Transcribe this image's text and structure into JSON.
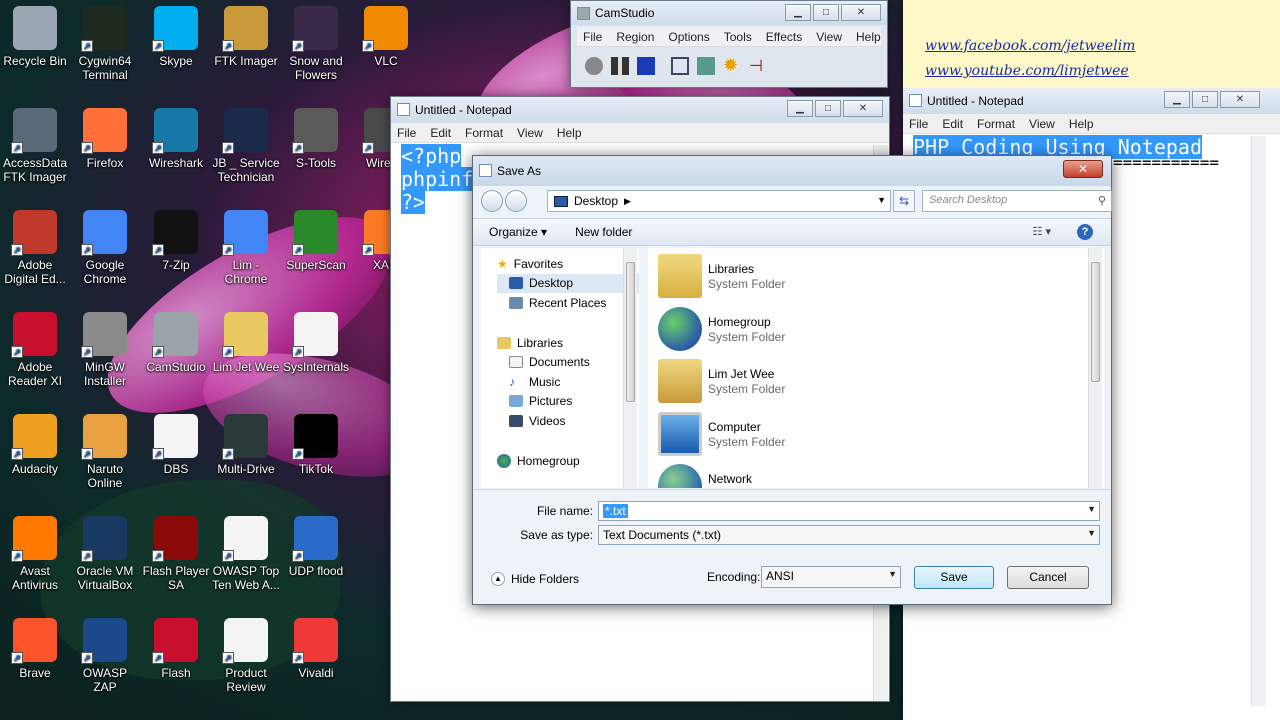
{
  "desktop_icons": [
    {
      "label": "Recycle Bin",
      "icon": "recycle-bin-icon",
      "color": "#9aa6b2"
    },
    {
      "label": "Cygwin64 Terminal",
      "icon": "terminal-icon",
      "color": "#1e2a1e"
    },
    {
      "label": "Skype",
      "icon": "skype-icon",
      "color": "#00aff0"
    },
    {
      "label": "FTK Imager",
      "icon": "magnifier-icon",
      "color": "#c89a3a"
    },
    {
      "label": "Snow and Flowers",
      "icon": "photo-icon",
      "color": "#3a2a4a"
    },
    {
      "label": "VLC",
      "icon": "vlc-cone-icon",
      "color": "#f08a00"
    },
    {
      "label": "AccessData FTK Imager",
      "icon": "disk-drive-icon",
      "color": "#5a6a7a"
    },
    {
      "label": "Firefox",
      "icon": "firefox-icon",
      "color": "#ff7139"
    },
    {
      "label": "Wireshark",
      "icon": "wireshark-fin-icon",
      "color": "#1679a7"
    },
    {
      "label": "JB _ Service Technician",
      "icon": "certificate-icon",
      "color": "#1a2a4a"
    },
    {
      "label": "S-Tools",
      "icon": "s-tools-icon",
      "color": "#5a5a5a"
    },
    {
      "label": "Wireles",
      "icon": "wireless-icon",
      "color": "#4a4a4a"
    },
    {
      "label": "Adobe Digital Ed...",
      "icon": "adobe-digital-editions-icon",
      "color": "#c0392b"
    },
    {
      "label": "Google Chrome",
      "icon": "chrome-icon",
      "color": "#4285f4"
    },
    {
      "label": "7-Zip",
      "icon": "7zip-icon",
      "color": "#111111"
    },
    {
      "label": "Lim - Chrome",
      "icon": "chrome-profile-icon",
      "color": "#4285f4"
    },
    {
      "label": "SuperScan",
      "icon": "network-monitor-icon",
      "color": "#2a8a2a"
    },
    {
      "label": "XAM",
      "icon": "xampp-icon",
      "color": "#fb7a24"
    },
    {
      "label": "Adobe Reader XI",
      "icon": "adobe-reader-icon",
      "color": "#c8102e"
    },
    {
      "label": "MinGW Installer",
      "icon": "mingw-installer-icon",
      "color": "#8a8a8a"
    },
    {
      "label": "CamStudio",
      "icon": "camstudio-icon",
      "color": "#9aa2aa"
    },
    {
      "label": "Lim Jet Wee",
      "icon": "user-folder-icon",
      "color": "#e8c860"
    },
    {
      "label": "SysInternals",
      "icon": "document-icon",
      "color": "#f4f4f4"
    },
    {
      "label": "Audacity",
      "icon": "audacity-icon",
      "color": "#f0a020"
    },
    {
      "label": "Naruto Online",
      "icon": "naruto-icon",
      "color": "#e8a040"
    },
    {
      "label": "DBS",
      "icon": "document-icon",
      "color": "#f4f4f4"
    },
    {
      "label": "Multi-Drive",
      "icon": "nox-icon",
      "color": "#2a3a3a"
    },
    {
      "label": "TikTok",
      "icon": "tiktok-icon",
      "color": "#000000"
    },
    {
      "label": "Avast Antivirus",
      "icon": "avast-icon",
      "color": "#ff7800"
    },
    {
      "label": "Oracle VM VirtualBox",
      "icon": "virtualbox-icon",
      "color": "#183a61"
    },
    {
      "label": "Flash Player SA",
      "icon": "flash-icon",
      "color": "#8a0a0a"
    },
    {
      "label": "OWASP Top Ten Web A...",
      "icon": "pdf-icon",
      "color": "#f4f4f4"
    },
    {
      "label": "UDP flood",
      "icon": "water-drops-icon",
      "color": "#2a6ac8"
    },
    {
      "label": "Brave",
      "icon": "brave-icon",
      "color": "#fb542b"
    },
    {
      "label": "OWASP ZAP",
      "icon": "zap-bolt-icon",
      "color": "#1a4a8a"
    },
    {
      "label": "Flash",
      "icon": "flash-icon",
      "color": "#c8102e"
    },
    {
      "label": "Product Review",
      "icon": "document-icon",
      "color": "#f4f4f4"
    },
    {
      "label": "Vivaldi",
      "icon": "vivaldi-icon",
      "color": "#ef3939"
    }
  ],
  "camstudio": {
    "title": "CamStudio",
    "menu": [
      "File",
      "Region",
      "Options",
      "Tools",
      "Effects",
      "View",
      "Help"
    ]
  },
  "notepad_left": {
    "title": "Untitled - Notepad",
    "menu": [
      "File",
      "Edit",
      "Format",
      "View",
      "Help"
    ],
    "lines": [
      "<?php",
      "phpinf",
      "?>"
    ]
  },
  "notepad_right": {
    "title": "Untitled - Notepad",
    "menu": [
      "File",
      "Edit",
      "Format",
      "View",
      "Help"
    ],
    "links": [
      "www.facebook.com/jetweelim",
      "www.youtube.com/limjetwee"
    ],
    "heading": "PHP Coding Using Notepad",
    "underline": "==========="
  },
  "save_dialog": {
    "title": "Save As",
    "location": "Desktop",
    "search_placeholder": "Search Desktop",
    "organize": "Organize",
    "new_folder": "New folder",
    "nav": {
      "favorites": "Favorites",
      "fav_items": [
        "Desktop",
        "Recent Places"
      ],
      "libraries": "Libraries",
      "lib_items": [
        "Documents",
        "Music",
        "Pictures",
        "Videos"
      ],
      "homegroup": "Homegroup"
    },
    "files": [
      {
        "name": "Libraries",
        "type": "System Folder"
      },
      {
        "name": "Homegroup",
        "type": "System Folder"
      },
      {
        "name": "Lim Jet Wee",
        "type": "System Folder"
      },
      {
        "name": "Computer",
        "type": "System Folder"
      },
      {
        "name": "Network",
        "type": ""
      }
    ],
    "file_name_label": "File name:",
    "file_name_value": "*.txt",
    "save_type_label": "Save as type:",
    "save_type_value": "Text Documents (*.txt)",
    "encoding_label": "Encoding:",
    "encoding_value": "ANSI",
    "hide_folders": "Hide Folders",
    "save": "Save",
    "cancel": "Cancel"
  }
}
